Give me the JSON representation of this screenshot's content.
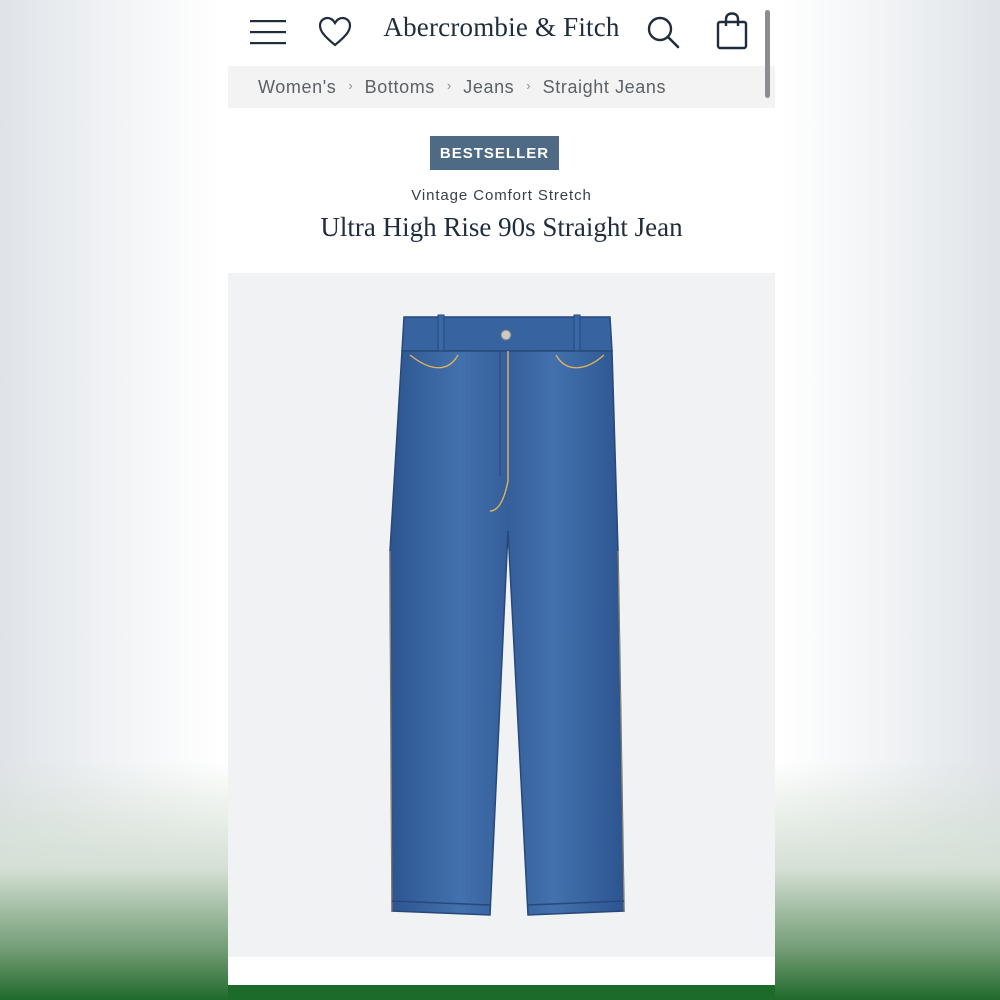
{
  "header": {
    "brand": "Abercrombie & Fitch",
    "icons": [
      "menu-icon",
      "heart-icon",
      "search-icon",
      "bag-icon"
    ]
  },
  "breadcrumb": [
    "Women's",
    "Bottoms",
    "Jeans",
    "Straight Jeans"
  ],
  "product": {
    "badge": "BESTSELLER",
    "subtitle": "Vintage Comfort Stretch",
    "title": "Ultra High Rise 90s Straight Jean",
    "image": "product-photo-blue-jeans"
  },
  "colors": {
    "badge_bg": "#4e6a85",
    "denim": "#3b66a3",
    "brand_green": "#1d6b2a"
  }
}
